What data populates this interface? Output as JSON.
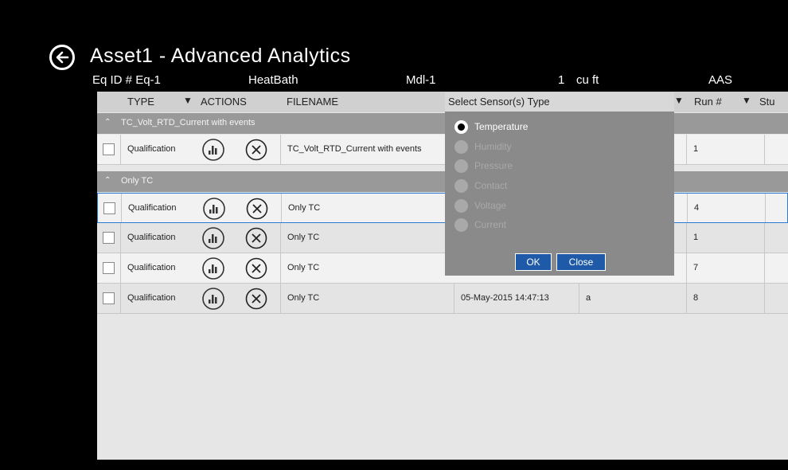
{
  "page": {
    "title": "Asset1 - Advanced Analytics"
  },
  "header": {
    "eq_id": "Eq ID # Eq-1",
    "type": "HeatBath",
    "model": "Mdl-1",
    "volume": "1",
    "unit": "cu ft",
    "manufacturer": "AAS"
  },
  "grid": {
    "columns": [
      "TYPE",
      "ACTIONS",
      "FILENAME",
      "Run #",
      "Stu"
    ],
    "filter_icon": "▼",
    "groups": [
      {
        "label": "TC_Volt_RTD_Current with events",
        "expanded": true
      },
      {
        "label": "Only TC",
        "expanded": true
      }
    ],
    "rows": [
      {
        "type": "Qualification",
        "filename": "TC_Volt_RTD_Current with events",
        "date": "",
        "user": "",
        "run": "1",
        "group": 0
      },
      {
        "type": "Qualification",
        "filename": "Only TC",
        "date": "",
        "user": "",
        "run": "4",
        "group": 1
      },
      {
        "type": "Qualification",
        "filename": "Only TC",
        "date": "",
        "user": "",
        "run": "1",
        "group": 1
      },
      {
        "type": "Qualification",
        "filename": "Only TC",
        "date": "",
        "user": "",
        "run": "7",
        "group": 1
      },
      {
        "type": "Qualification",
        "filename": "Only TC",
        "date": "05-May-2015 14:47:13",
        "user": "a",
        "run": "8",
        "group": 1
      }
    ]
  },
  "dialog": {
    "title": "Select Sensor(s) Type",
    "options": [
      {
        "label": "Temperature",
        "selected": true
      },
      {
        "label": "Humidity",
        "selected": false
      },
      {
        "label": "Pressure",
        "selected": false
      },
      {
        "label": "Contact",
        "selected": false
      },
      {
        "label": "Voltage",
        "selected": false
      },
      {
        "label": "Current",
        "selected": false
      }
    ],
    "ok_label": "OK",
    "close_label": "Close"
  },
  "colors": {
    "accent": "#1e5aa8",
    "selection_border": "#2b7bd4",
    "group_bar": "#999999",
    "background": "#000000"
  }
}
